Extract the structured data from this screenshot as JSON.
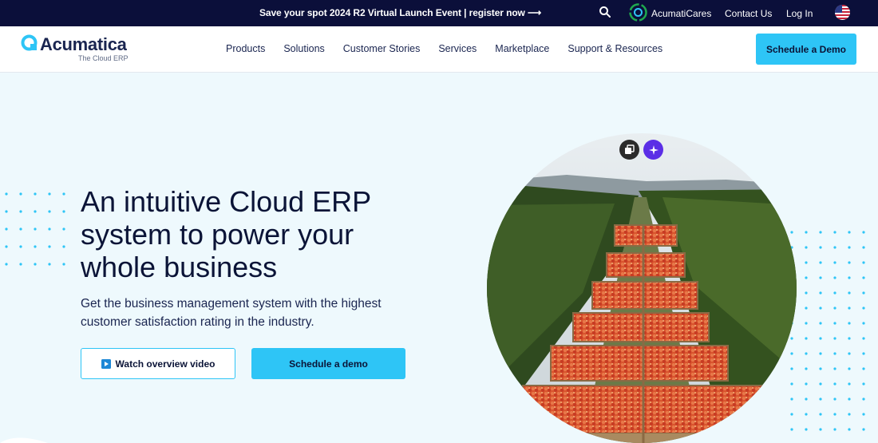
{
  "topbar": {
    "announcement": "Save your spot 2024 R2 Virtual Launch Event | register now ⟶",
    "cares_label": "AcumatiCares",
    "contact_label": "Contact Us",
    "login_label": "Log In"
  },
  "header": {
    "logo_text": "Acumatica",
    "logo_tagline": "The Cloud ERP",
    "nav": [
      "Products",
      "Solutions",
      "Customer Stories",
      "Services",
      "Marketplace",
      "Support & Resources"
    ],
    "cta_label": "Schedule a Demo"
  },
  "hero": {
    "title": "An intuitive Cloud ERP system to power your whole business",
    "subtitle": "Get the business management system with the highest customer satisfaction rating in the industry.",
    "video_button_label": "Watch overview video",
    "demo_button_label": "Schedule a demo"
  },
  "colors": {
    "topbar_bg": "#0b0f3a",
    "accent": "#2ec5f6",
    "hero_bg": "#eef9fd",
    "text_dark": "#0b1437",
    "sparkle_button": "#5b2ee6"
  },
  "icons": [
    "search-icon",
    "acumaticares-logo-icon",
    "us-flag-icon",
    "acumatica-logo-icon",
    "play-icon",
    "copy-icon",
    "sparkle-icon"
  ]
}
